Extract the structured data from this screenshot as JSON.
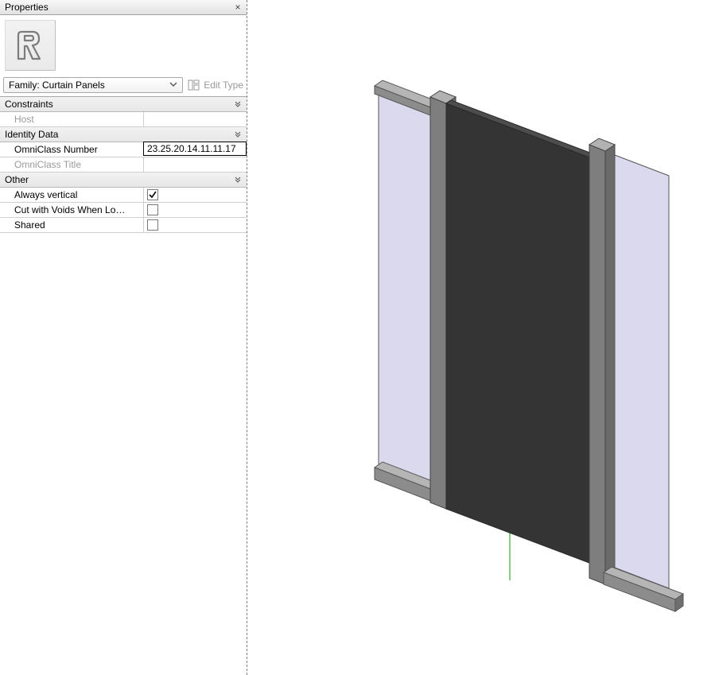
{
  "palette": {
    "title": "Properties",
    "close_glyph": "×",
    "family_selector": {
      "label": "Family: Curtain Panels"
    },
    "edit_type_label": "Edit Type",
    "groups": [
      {
        "name": "Constraints",
        "rows": [
          {
            "label": "Host",
            "value": "",
            "readonly": true,
            "type": "text"
          }
        ]
      },
      {
        "name": "Identity Data",
        "rows": [
          {
            "label": "OmniClass Number",
            "value": "23.25.20.14.11.11.17",
            "readonly": false,
            "type": "text",
            "editing": true
          },
          {
            "label": "OmniClass Title",
            "value": "",
            "readonly": true,
            "type": "text"
          }
        ]
      },
      {
        "name": "Other",
        "rows": [
          {
            "label": "Always vertical",
            "checked": true,
            "type": "check"
          },
          {
            "label": "Cut with Voids When Lo…",
            "checked": false,
            "type": "check"
          },
          {
            "label": "Shared",
            "checked": false,
            "type": "check"
          }
        ]
      }
    ]
  }
}
